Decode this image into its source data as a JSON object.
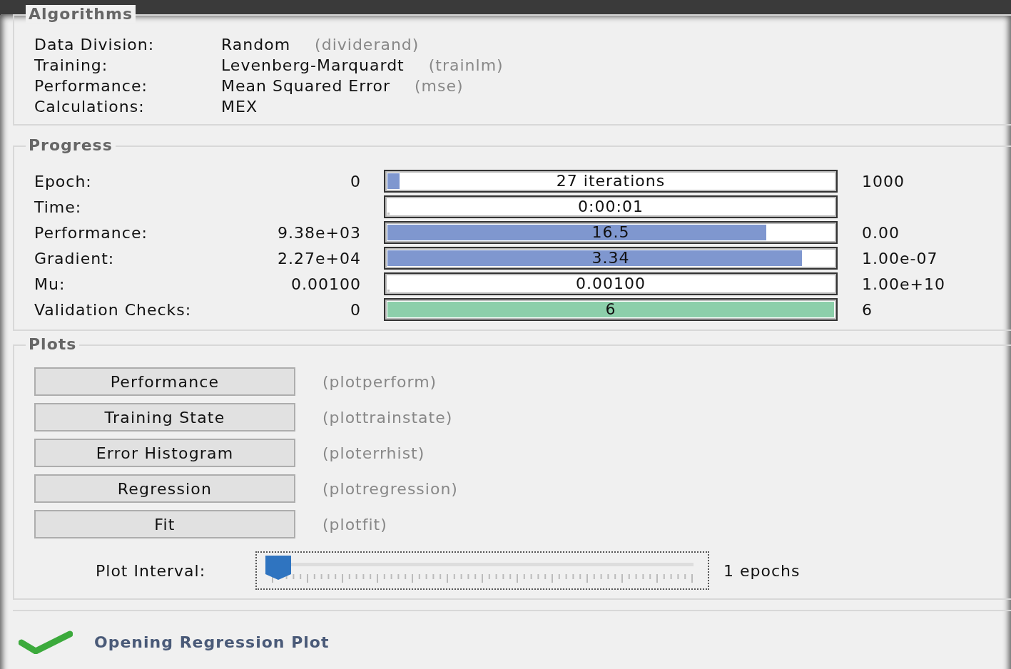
{
  "algorithms": {
    "title": "Algorithms",
    "rows": [
      {
        "label": "Data Division:",
        "value": "Random",
        "function": "(dividerand)"
      },
      {
        "label": "Training:",
        "value": "Levenberg-Marquardt",
        "function": "(trainlm)"
      },
      {
        "label": "Performance:",
        "value": "Mean Squared Error",
        "function": "(mse)"
      },
      {
        "label": "Calculations:",
        "value": "MEX"
      }
    ]
  },
  "progress": {
    "title": "Progress",
    "rows": [
      {
        "label": "Epoch:",
        "start": "0",
        "reading": "27 iterations",
        "level": 0.027,
        "color": "#7f97cf",
        "end": "1000"
      },
      {
        "label": "Time:",
        "reading": "0:00:01",
        "level": 0
      },
      {
        "label": "Performance:",
        "start": "9.38e+03",
        "reading": "16.5",
        "level": 0.84,
        "color": "#7f97cf",
        "end": "0.00"
      },
      {
        "label": "Gradient:",
        "start": "2.27e+04",
        "reading": "3.34",
        "level": 0.92,
        "color": "#7f97cf",
        "end": "1.00e-07"
      },
      {
        "label": "Mu:",
        "start": "0.00100",
        "reading": "0.00100",
        "level": 0,
        "end": "1.00e+10"
      },
      {
        "label": "Validation Checks:",
        "start": "0",
        "reading": "6",
        "level": 1,
        "color": "#8ccfaa",
        "end": "6"
      }
    ]
  },
  "plots": {
    "title": "Plots",
    "buttons": [
      {
        "label": "Performance",
        "function": "(plotperform)"
      },
      {
        "label": "Training State",
        "function": "(plottrainstate)"
      },
      {
        "label": "Error Histogram",
        "function": "(ploterrhist)"
      },
      {
        "label": "Regression",
        "function": "(plotregression)"
      },
      {
        "label": "Fit",
        "function": "(plotfit)"
      }
    ],
    "interval": {
      "label": "Plot Interval:",
      "level": 0,
      "reading": "1 epochs"
    }
  },
  "status_bar": {
    "message": "Opening Regression Plot"
  }
}
